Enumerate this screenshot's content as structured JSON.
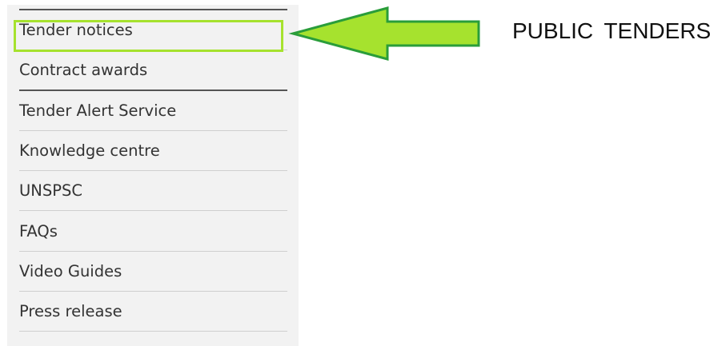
{
  "menu": {
    "items": [
      {
        "label": "Tender notices"
      },
      {
        "label": "Contract awards"
      },
      {
        "label": "Tender Alert Service"
      },
      {
        "label": "Knowledge centre"
      },
      {
        "label": "UNSPSC"
      },
      {
        "label": "FAQs"
      },
      {
        "label": "Video Guides"
      },
      {
        "label": "Press release"
      }
    ],
    "highlighted_item": "Tender notices"
  },
  "annotation": {
    "text": "PUBLIC  TENDERS",
    "arrow_direction": "left",
    "arrow_color": "#a6e22e",
    "arrow_border_color": "#2a9d3a"
  }
}
